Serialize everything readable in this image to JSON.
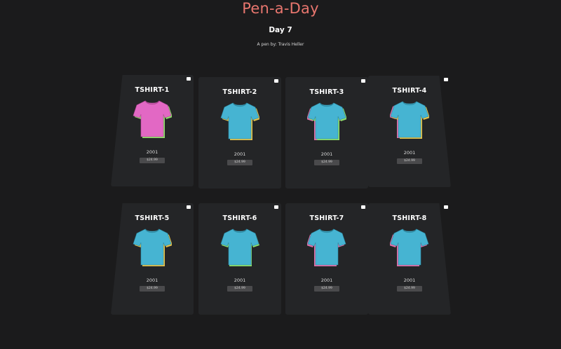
{
  "header": {
    "title": "Pen-a-Day",
    "subtitle": "Day 7",
    "byline": "A pen by: Travis Heller"
  },
  "colors": {
    "title": "#e8766e",
    "background": "#1b1b1c",
    "card": "#242527",
    "shirt_pink": "#e268c4",
    "shirt_blue": "#46b4d2"
  },
  "cards": [
    {
      "title": "TSHIRT-1",
      "year": "2001",
      "price": "$24.99",
      "shirt_color": "pink",
      "toggle_icon": "square-toggle-icon"
    },
    {
      "title": "TSHIRT-2",
      "year": "2001",
      "price": "$24.99",
      "shirt_color": "blue",
      "toggle_icon": "square-toggle-icon"
    },
    {
      "title": "TSHIRT-3",
      "year": "2001",
      "price": "$24.99",
      "shirt_color": "blue",
      "toggle_icon": "square-toggle-icon"
    },
    {
      "title": "TSHIRT-4",
      "year": "2001",
      "price": "$24.99",
      "shirt_color": "blue",
      "toggle_icon": "square-toggle-icon"
    },
    {
      "title": "TSHIRT-5",
      "year": "2001",
      "price": "$24.99",
      "shirt_color": "blue",
      "toggle_icon": "square-toggle-icon"
    },
    {
      "title": "TSHIRT-6",
      "year": "2001",
      "price": "$24.99",
      "shirt_color": "blue",
      "toggle_icon": "square-toggle-icon"
    },
    {
      "title": "TSHIRT-7",
      "year": "2001",
      "price": "$24.99",
      "shirt_color": "blue",
      "toggle_icon": "square-toggle-icon"
    },
    {
      "title": "TSHIRT-8",
      "year": "2001",
      "price": "$24.99",
      "shirt_color": "blue",
      "toggle_icon": "square-toggle-icon"
    }
  ]
}
